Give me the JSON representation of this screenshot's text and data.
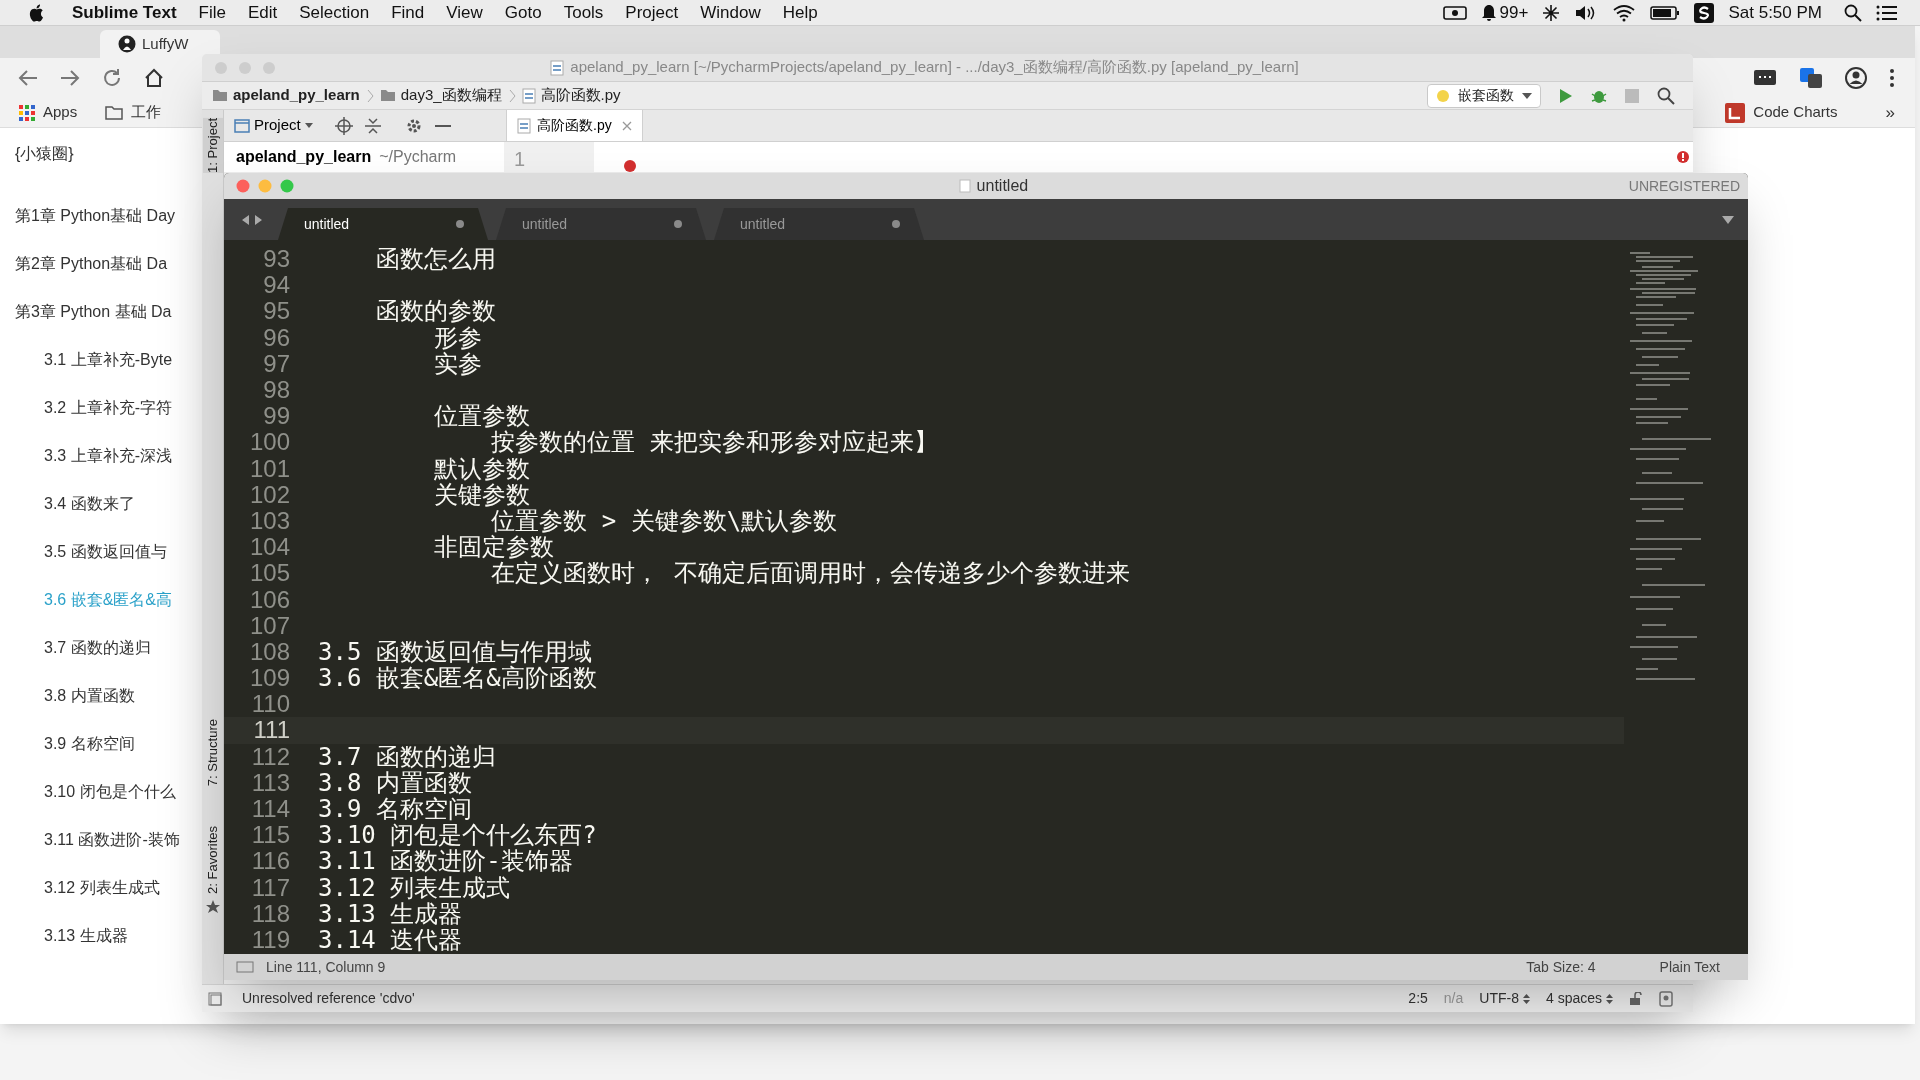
{
  "menu_bar": {
    "app": "Sublime Text",
    "menus": [
      "File",
      "Edit",
      "Selection",
      "Find",
      "View",
      "Goto",
      "Tools",
      "Project",
      "Window",
      "Help"
    ],
    "notification_count": "99+",
    "clock": "Sat 5:50 PM"
  },
  "browser": {
    "tab_title": "LuffyW",
    "bookmarks": [
      "Apps",
      "工作"
    ],
    "extension_bookmark": "Code Charts",
    "more": "»",
    "sidebar": {
      "title": "{小猿圈}",
      "items": [
        {
          "label": "第1章 Python基础 Day",
          "selected": false
        },
        {
          "label": "第2章 Python基础 Da",
          "selected": false
        },
        {
          "label": "第3章 Python 基础 Da",
          "selected": false,
          "children": [
            {
              "label": "3.1 上章补充-Byte",
              "selected": false
            },
            {
              "label": "3.2 上章补充-字符",
              "selected": false
            },
            {
              "label": "3.3 上章补充-深浅",
              "selected": false
            },
            {
              "label": "3.4 函数来了",
              "selected": false
            },
            {
              "label": "3.5 函数返回值与",
              "selected": false
            },
            {
              "label": "3.6 嵌套&匿名&高",
              "selected": true
            },
            {
              "label": "3.7 函数的递归",
              "selected": false
            },
            {
              "label": "3.8 内置函数",
              "selected": false
            },
            {
              "label": "3.9 名称空间",
              "selected": false
            },
            {
              "label": "3.10 闭包是个什么",
              "selected": false
            },
            {
              "label": "3.11 函数进阶-装饰",
              "selected": false
            },
            {
              "label": "3.12 列表生成式",
              "selected": false
            },
            {
              "label": "3.13 生成器",
              "selected": false
            }
          ]
        }
      ]
    }
  },
  "pycharm": {
    "title": "apeland_py_learn [~/PycharmProjects/apeland_py_learn] - .../day3_函数编程/高阶函数.py [apeland_py_learn]",
    "breadcrumbs": [
      "apeland_py_learn",
      "day3_函数编程",
      "高阶函数.py"
    ],
    "run_config": "嵌套函数",
    "project_label": "Project",
    "file_tab": "高阶函数.py",
    "project_root": "apeland_py_learn",
    "project_path": "~/Pycharm",
    "line_number": "1",
    "tool_tabs": [
      {
        "label": "1: Project",
        "selected": true
      },
      {
        "label": "7: Structure",
        "selected": false
      },
      {
        "label": "2: Favorites",
        "selected": false
      }
    ],
    "status": {
      "message": "Unresolved reference 'cdvo'",
      "position": "2:5",
      "na": "n/a",
      "encoding": "UTF-8",
      "indent": "4 spaces"
    }
  },
  "sublime": {
    "title": "untitled",
    "license": "UNREGISTERED",
    "tabs": [
      {
        "label": "untitled",
        "selected": true,
        "modified": true
      },
      {
        "label": "untitled",
        "selected": false,
        "modified": true
      },
      {
        "label": "untitled",
        "selected": false,
        "modified": true
      }
    ],
    "lines": [
      {
        "number": "93",
        "text": "    函数怎么用",
        "current": false
      },
      {
        "number": "94",
        "current": false
      },
      {
        "number": "95",
        "text": "    函数的参数",
        "current": false
      },
      {
        "number": "96",
        "text": "        形参",
        "current": false
      },
      {
        "number": "97",
        "text": "        实参",
        "current": false
      },
      {
        "number": "98",
        "current": false
      },
      {
        "number": "99",
        "text": "        位置参数",
        "current": false
      },
      {
        "number": "100",
        "text": "            按参数的位置 来把实参和形参对应起来】",
        "current": false
      },
      {
        "number": "101",
        "text": "        默认参数",
        "current": false
      },
      {
        "number": "102",
        "text": "        关键参数",
        "current": false
      },
      {
        "number": "103",
        "text": "            位置参数 > 关键参数\\默认参数",
        "current": false
      },
      {
        "number": "104",
        "text": "        非固定参数",
        "current": false
      },
      {
        "number": "105",
        "text": "            在定义函数时， 不确定后面调用时，会传递多少个参数进来",
        "current": false
      },
      {
        "number": "106",
        "current": false
      },
      {
        "number": "107",
        "current": false
      },
      {
        "number": "108",
        "text": "3.5 函数返回值与作用域",
        "current": false
      },
      {
        "number": "109",
        "text": "3.6 嵌套&匿名&高阶函数",
        "current": false
      },
      {
        "number": "110",
        "current": false
      },
      {
        "number": "111",
        "current": true
      },
      {
        "number": "112",
        "text": "3.7 函数的递归",
        "current": false
      },
      {
        "number": "113",
        "text": "3.8 内置函数",
        "current": false
      },
      {
        "number": "114",
        "text": "3.9 名称空间",
        "current": false
      },
      {
        "number": "115",
        "text": "3.10 闭包是个什么东西?",
        "current": false
      },
      {
        "number": "116",
        "text": "3.11 函数进阶-装饰器",
        "current": false
      },
      {
        "number": "117",
        "text": "3.12 列表生成式",
        "current": false
      },
      {
        "number": "118",
        "text": "3.13 生成器",
        "current": false
      },
      {
        "number": "119",
        "text": "3.14 迭代器",
        "current": false
      }
    ],
    "status": {
      "position": "Line 111, Column 9",
      "tab_size": "Tab Size: 4",
      "syntax": "Plain Text"
    }
  }
}
